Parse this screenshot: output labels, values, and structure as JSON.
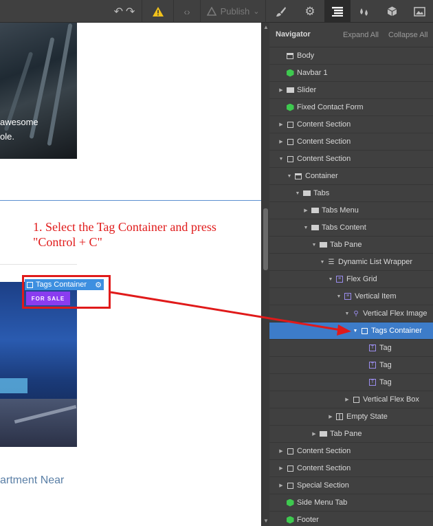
{
  "toolbar": {
    "undo_icon": "undo-icon",
    "redo_icon": "redo-icon",
    "warning_icon": "warning-icon",
    "code_icon": "code-icon",
    "publish_label": "Publish",
    "publish_caret": "⌄",
    "tabs": [
      "style-brush",
      "settings-gear",
      "navigator",
      "interactions-drops",
      "symbols-cube",
      "assets-image"
    ]
  },
  "canvas": {
    "hero_text_line1": "awesome",
    "hero_text_line2": "ole.",
    "annotation_line1": "1. Select the Tag Container and press",
    "annotation_line2": "\"Control + C\"",
    "selection_label": "Tags Container",
    "tag_pill": "FOR SALE",
    "card_title": "artment Near"
  },
  "navigator": {
    "title": "Navigator",
    "expand_all": "Expand All",
    "collapse_all": "Collapse All",
    "items": [
      {
        "label": "Body",
        "depth": 0,
        "arrow": "",
        "icon": "body"
      },
      {
        "label": "Navbar 1",
        "depth": 0,
        "arrow": "",
        "icon": "cube"
      },
      {
        "label": "Slider",
        "depth": 0,
        "arrow": "▶",
        "icon": "dark"
      },
      {
        "label": "Fixed Contact Form",
        "depth": 0,
        "arrow": "",
        "icon": "cube"
      },
      {
        "label": "Content Section",
        "depth": 0,
        "arrow": "▶",
        "icon": "box"
      },
      {
        "label": "Content Section",
        "depth": 0,
        "arrow": "▶",
        "icon": "box"
      },
      {
        "label": "Content Section",
        "depth": 0,
        "arrow": "▼",
        "icon": "box"
      },
      {
        "label": "Container",
        "depth": 1,
        "arrow": "▼",
        "icon": "body"
      },
      {
        "label": "Tabs",
        "depth": 2,
        "arrow": "▼",
        "icon": "dark"
      },
      {
        "label": "Tabs Menu",
        "depth": 3,
        "arrow": "▶",
        "icon": "dark"
      },
      {
        "label": "Tabs Content",
        "depth": 3,
        "arrow": "▼",
        "icon": "dark"
      },
      {
        "label": "Tab Pane",
        "depth": 4,
        "arrow": "▼",
        "icon": "dark"
      },
      {
        "label": "Dynamic List Wrapper",
        "depth": 5,
        "arrow": "▼",
        "icon": "list"
      },
      {
        "label": "Flex Grid",
        "depth": 6,
        "arrow": "▼",
        "icon": "purple"
      },
      {
        "label": "Vertical Item",
        "depth": 7,
        "arrow": "▼",
        "icon": "purple"
      },
      {
        "label": "Vertical Flex Image",
        "depth": 8,
        "arrow": "▼",
        "icon": "link"
      },
      {
        "label": "Tags Container",
        "depth": 9,
        "arrow": "▼",
        "icon": "box",
        "selected": true
      },
      {
        "label": "Tag",
        "depth": 10,
        "arrow": "",
        "icon": "tag"
      },
      {
        "label": "Tag",
        "depth": 10,
        "arrow": "",
        "icon": "tag"
      },
      {
        "label": "Tag",
        "depth": 10,
        "arrow": "",
        "icon": "tag"
      },
      {
        "label": "Vertical Flex Box",
        "depth": 8,
        "arrow": "▶",
        "icon": "box"
      },
      {
        "label": "Empty State",
        "depth": 6,
        "arrow": "▶",
        "icon": "grid"
      },
      {
        "label": "Tab Pane",
        "depth": 4,
        "arrow": "▶",
        "icon": "dark"
      },
      {
        "label": "Content Section",
        "depth": 0,
        "arrow": "▶",
        "icon": "box"
      },
      {
        "label": "Content Section",
        "depth": 0,
        "arrow": "▶",
        "icon": "box"
      },
      {
        "label": "Special Section",
        "depth": 0,
        "arrow": "▶",
        "icon": "box"
      },
      {
        "label": "Side Menu Tab",
        "depth": 0,
        "arrow": "",
        "icon": "cube"
      },
      {
        "label": "Footer",
        "depth": 0,
        "arrow": "",
        "icon": "cube"
      }
    ]
  },
  "colors": {
    "annotation_red": "#e01a1a",
    "selection_blue": "#3d7cc9",
    "tag_purple": "#8a3cf0",
    "component_green": "#3ec94f"
  }
}
